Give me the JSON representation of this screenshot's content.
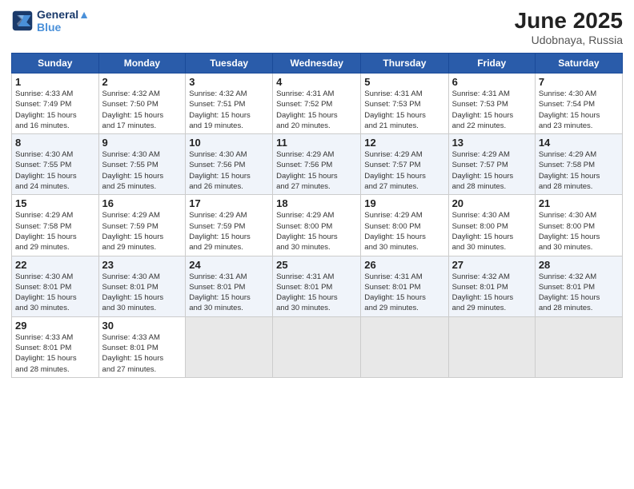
{
  "logo": {
    "line1": "General",
    "line2": "Blue"
  },
  "title": "June 2025",
  "location": "Udobnaya, Russia",
  "days_header": [
    "Sunday",
    "Monday",
    "Tuesday",
    "Wednesday",
    "Thursday",
    "Friday",
    "Saturday"
  ],
  "weeks": [
    [
      {
        "day": "1",
        "info": "Sunrise: 4:33 AM\nSunset: 7:49 PM\nDaylight: 15 hours\nand 16 minutes."
      },
      {
        "day": "2",
        "info": "Sunrise: 4:32 AM\nSunset: 7:50 PM\nDaylight: 15 hours\nand 17 minutes."
      },
      {
        "day": "3",
        "info": "Sunrise: 4:32 AM\nSunset: 7:51 PM\nDaylight: 15 hours\nand 19 minutes."
      },
      {
        "day": "4",
        "info": "Sunrise: 4:31 AM\nSunset: 7:52 PM\nDaylight: 15 hours\nand 20 minutes."
      },
      {
        "day": "5",
        "info": "Sunrise: 4:31 AM\nSunset: 7:53 PM\nDaylight: 15 hours\nand 21 minutes."
      },
      {
        "day": "6",
        "info": "Sunrise: 4:31 AM\nSunset: 7:53 PM\nDaylight: 15 hours\nand 22 minutes."
      },
      {
        "day": "7",
        "info": "Sunrise: 4:30 AM\nSunset: 7:54 PM\nDaylight: 15 hours\nand 23 minutes."
      }
    ],
    [
      {
        "day": "8",
        "info": "Sunrise: 4:30 AM\nSunset: 7:55 PM\nDaylight: 15 hours\nand 24 minutes."
      },
      {
        "day": "9",
        "info": "Sunrise: 4:30 AM\nSunset: 7:55 PM\nDaylight: 15 hours\nand 25 minutes."
      },
      {
        "day": "10",
        "info": "Sunrise: 4:30 AM\nSunset: 7:56 PM\nDaylight: 15 hours\nand 26 minutes."
      },
      {
        "day": "11",
        "info": "Sunrise: 4:29 AM\nSunset: 7:56 PM\nDaylight: 15 hours\nand 27 minutes."
      },
      {
        "day": "12",
        "info": "Sunrise: 4:29 AM\nSunset: 7:57 PM\nDaylight: 15 hours\nand 27 minutes."
      },
      {
        "day": "13",
        "info": "Sunrise: 4:29 AM\nSunset: 7:57 PM\nDaylight: 15 hours\nand 28 minutes."
      },
      {
        "day": "14",
        "info": "Sunrise: 4:29 AM\nSunset: 7:58 PM\nDaylight: 15 hours\nand 28 minutes."
      }
    ],
    [
      {
        "day": "15",
        "info": "Sunrise: 4:29 AM\nSunset: 7:58 PM\nDaylight: 15 hours\nand 29 minutes."
      },
      {
        "day": "16",
        "info": "Sunrise: 4:29 AM\nSunset: 7:59 PM\nDaylight: 15 hours\nand 29 minutes."
      },
      {
        "day": "17",
        "info": "Sunrise: 4:29 AM\nSunset: 7:59 PM\nDaylight: 15 hours\nand 29 minutes."
      },
      {
        "day": "18",
        "info": "Sunrise: 4:29 AM\nSunset: 8:00 PM\nDaylight: 15 hours\nand 30 minutes."
      },
      {
        "day": "19",
        "info": "Sunrise: 4:29 AM\nSunset: 8:00 PM\nDaylight: 15 hours\nand 30 minutes."
      },
      {
        "day": "20",
        "info": "Sunrise: 4:30 AM\nSunset: 8:00 PM\nDaylight: 15 hours\nand 30 minutes."
      },
      {
        "day": "21",
        "info": "Sunrise: 4:30 AM\nSunset: 8:00 PM\nDaylight: 15 hours\nand 30 minutes."
      }
    ],
    [
      {
        "day": "22",
        "info": "Sunrise: 4:30 AM\nSunset: 8:01 PM\nDaylight: 15 hours\nand 30 minutes."
      },
      {
        "day": "23",
        "info": "Sunrise: 4:30 AM\nSunset: 8:01 PM\nDaylight: 15 hours\nand 30 minutes."
      },
      {
        "day": "24",
        "info": "Sunrise: 4:31 AM\nSunset: 8:01 PM\nDaylight: 15 hours\nand 30 minutes."
      },
      {
        "day": "25",
        "info": "Sunrise: 4:31 AM\nSunset: 8:01 PM\nDaylight: 15 hours\nand 30 minutes."
      },
      {
        "day": "26",
        "info": "Sunrise: 4:31 AM\nSunset: 8:01 PM\nDaylight: 15 hours\nand 29 minutes."
      },
      {
        "day": "27",
        "info": "Sunrise: 4:32 AM\nSunset: 8:01 PM\nDaylight: 15 hours\nand 29 minutes."
      },
      {
        "day": "28",
        "info": "Sunrise: 4:32 AM\nSunset: 8:01 PM\nDaylight: 15 hours\nand 28 minutes."
      }
    ],
    [
      {
        "day": "29",
        "info": "Sunrise: 4:33 AM\nSunset: 8:01 PM\nDaylight: 15 hours\nand 28 minutes."
      },
      {
        "day": "30",
        "info": "Sunrise: 4:33 AM\nSunset: 8:01 PM\nDaylight: 15 hours\nand 27 minutes."
      },
      {
        "day": "",
        "info": ""
      },
      {
        "day": "",
        "info": ""
      },
      {
        "day": "",
        "info": ""
      },
      {
        "day": "",
        "info": ""
      },
      {
        "day": "",
        "info": ""
      }
    ]
  ]
}
